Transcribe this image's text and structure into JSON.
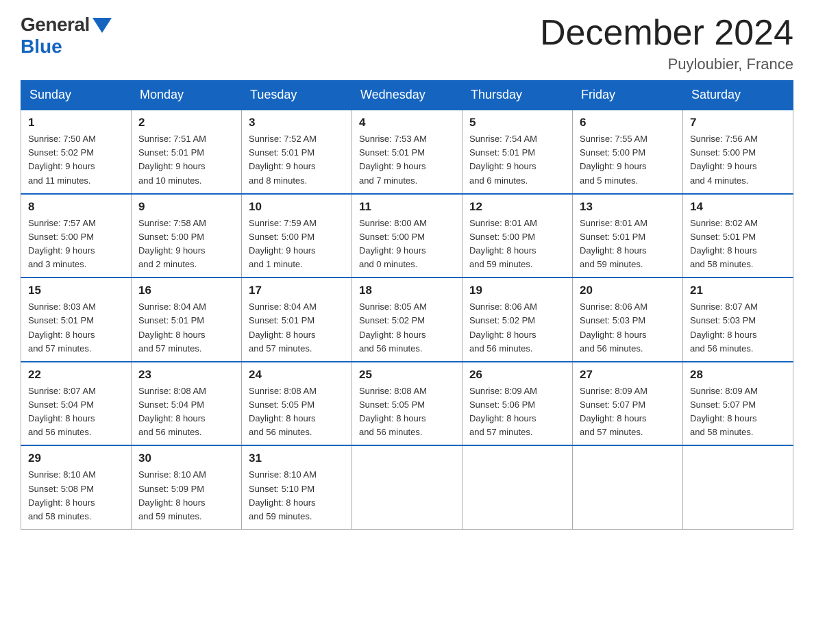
{
  "header": {
    "logo_general": "General",
    "logo_blue": "Blue",
    "month_title": "December 2024",
    "location": "Puyloubier, France"
  },
  "weekdays": [
    "Sunday",
    "Monday",
    "Tuesday",
    "Wednesday",
    "Thursday",
    "Friday",
    "Saturday"
  ],
  "weeks": [
    [
      {
        "day": "1",
        "sunrise": "7:50 AM",
        "sunset": "5:02 PM",
        "daylight": "9 hours and 11 minutes."
      },
      {
        "day": "2",
        "sunrise": "7:51 AM",
        "sunset": "5:01 PM",
        "daylight": "9 hours and 10 minutes."
      },
      {
        "day": "3",
        "sunrise": "7:52 AM",
        "sunset": "5:01 PM",
        "daylight": "9 hours and 8 minutes."
      },
      {
        "day": "4",
        "sunrise": "7:53 AM",
        "sunset": "5:01 PM",
        "daylight": "9 hours and 7 minutes."
      },
      {
        "day": "5",
        "sunrise": "7:54 AM",
        "sunset": "5:01 PM",
        "daylight": "9 hours and 6 minutes."
      },
      {
        "day": "6",
        "sunrise": "7:55 AM",
        "sunset": "5:00 PM",
        "daylight": "9 hours and 5 minutes."
      },
      {
        "day": "7",
        "sunrise": "7:56 AM",
        "sunset": "5:00 PM",
        "daylight": "9 hours and 4 minutes."
      }
    ],
    [
      {
        "day": "8",
        "sunrise": "7:57 AM",
        "sunset": "5:00 PM",
        "daylight": "9 hours and 3 minutes."
      },
      {
        "day": "9",
        "sunrise": "7:58 AM",
        "sunset": "5:00 PM",
        "daylight": "9 hours and 2 minutes."
      },
      {
        "day": "10",
        "sunrise": "7:59 AM",
        "sunset": "5:00 PM",
        "daylight": "9 hours and 1 minute."
      },
      {
        "day": "11",
        "sunrise": "8:00 AM",
        "sunset": "5:00 PM",
        "daylight": "9 hours and 0 minutes."
      },
      {
        "day": "12",
        "sunrise": "8:01 AM",
        "sunset": "5:00 PM",
        "daylight": "8 hours and 59 minutes."
      },
      {
        "day": "13",
        "sunrise": "8:01 AM",
        "sunset": "5:01 PM",
        "daylight": "8 hours and 59 minutes."
      },
      {
        "day": "14",
        "sunrise": "8:02 AM",
        "sunset": "5:01 PM",
        "daylight": "8 hours and 58 minutes."
      }
    ],
    [
      {
        "day": "15",
        "sunrise": "8:03 AM",
        "sunset": "5:01 PM",
        "daylight": "8 hours and 57 minutes."
      },
      {
        "day": "16",
        "sunrise": "8:04 AM",
        "sunset": "5:01 PM",
        "daylight": "8 hours and 57 minutes."
      },
      {
        "day": "17",
        "sunrise": "8:04 AM",
        "sunset": "5:01 PM",
        "daylight": "8 hours and 57 minutes."
      },
      {
        "day": "18",
        "sunrise": "8:05 AM",
        "sunset": "5:02 PM",
        "daylight": "8 hours and 56 minutes."
      },
      {
        "day": "19",
        "sunrise": "8:06 AM",
        "sunset": "5:02 PM",
        "daylight": "8 hours and 56 minutes."
      },
      {
        "day": "20",
        "sunrise": "8:06 AM",
        "sunset": "5:03 PM",
        "daylight": "8 hours and 56 minutes."
      },
      {
        "day": "21",
        "sunrise": "8:07 AM",
        "sunset": "5:03 PM",
        "daylight": "8 hours and 56 minutes."
      }
    ],
    [
      {
        "day": "22",
        "sunrise": "8:07 AM",
        "sunset": "5:04 PM",
        "daylight": "8 hours and 56 minutes."
      },
      {
        "day": "23",
        "sunrise": "8:08 AM",
        "sunset": "5:04 PM",
        "daylight": "8 hours and 56 minutes."
      },
      {
        "day": "24",
        "sunrise": "8:08 AM",
        "sunset": "5:05 PM",
        "daylight": "8 hours and 56 minutes."
      },
      {
        "day": "25",
        "sunrise": "8:08 AM",
        "sunset": "5:05 PM",
        "daylight": "8 hours and 56 minutes."
      },
      {
        "day": "26",
        "sunrise": "8:09 AM",
        "sunset": "5:06 PM",
        "daylight": "8 hours and 57 minutes."
      },
      {
        "day": "27",
        "sunrise": "8:09 AM",
        "sunset": "5:07 PM",
        "daylight": "8 hours and 57 minutes."
      },
      {
        "day": "28",
        "sunrise": "8:09 AM",
        "sunset": "5:07 PM",
        "daylight": "8 hours and 58 minutes."
      }
    ],
    [
      {
        "day": "29",
        "sunrise": "8:10 AM",
        "sunset": "5:08 PM",
        "daylight": "8 hours and 58 minutes."
      },
      {
        "day": "30",
        "sunrise": "8:10 AM",
        "sunset": "5:09 PM",
        "daylight": "8 hours and 59 minutes."
      },
      {
        "day": "31",
        "sunrise": "8:10 AM",
        "sunset": "5:10 PM",
        "daylight": "8 hours and 59 minutes."
      },
      null,
      null,
      null,
      null
    ]
  ],
  "labels": {
    "sunrise": "Sunrise:",
    "sunset": "Sunset:",
    "daylight": "Daylight:"
  }
}
